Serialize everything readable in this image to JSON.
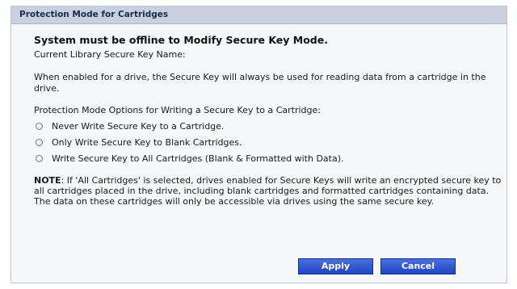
{
  "panel": {
    "title": "Protection Mode for Cartridges"
  },
  "main": {
    "heading": "System must be offline to Modify Secure Key Mode.",
    "current_key_label": "Current Library Secure Key Name:",
    "description": "When enabled for a drive, the Secure Key will always be used for reading data from a cartridge in the drive.",
    "options_title": "Protection Mode Options for Writing a Secure Key to a Cartridge:",
    "options": [
      {
        "label": "Never Write Secure Key to a Cartridge.",
        "selected": false
      },
      {
        "label": "Only Write Secure Key to Blank Cartridges.",
        "selected": false
      },
      {
        "label": "Write Secure Key to All Cartridges (Blank & Formatted with Data).",
        "selected": false
      }
    ],
    "note_label": "NOTE",
    "note_text": ": If 'All Cartridges' is selected, drives enabled for Secure Keys will write an encrypted secure key to all cartridges placed in the drive, including blank cartridges and formatted cartridges containing data. The data on these cartridges will only be accessible via drives using the same secure key."
  },
  "buttons": {
    "apply": "Apply",
    "cancel": "Cancel"
  },
  "colors": {
    "header_bg": "#c8d0df",
    "button_blue": "#2b52d0"
  }
}
